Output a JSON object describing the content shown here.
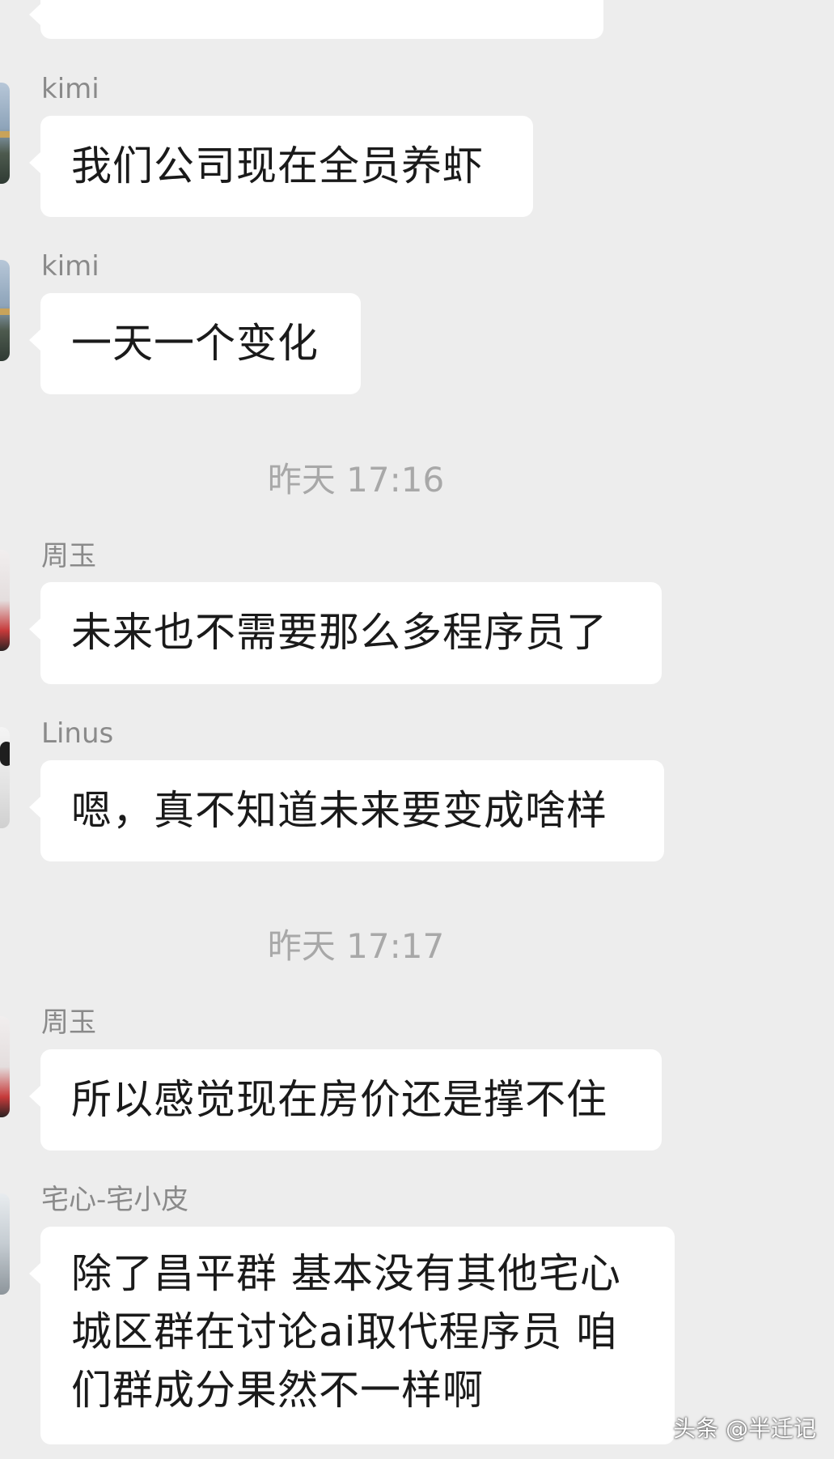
{
  "messages": [
    {
      "sender": "",
      "text": ""
    },
    {
      "sender": "kimi",
      "text": "我们公司现在全员养虾"
    },
    {
      "sender": "kimi",
      "text": "一天一个变化"
    },
    {
      "sender": "周玉",
      "text": "未来也不需要那么多程序员了"
    },
    {
      "sender": "Linus",
      "text": "嗯，真不知道未来要变成啥样"
    },
    {
      "sender": "周玉",
      "text": "所以感觉现在房价还是撑不住"
    },
    {
      "sender": "宅心-宅小皮",
      "text": "除了昌平群 基本没有其他宅心城区群在讨论ai取代程序员 咱们群成分果然不一样啊"
    }
  ],
  "timestamps": [
    "昨天 17:16",
    "昨天 17:17"
  ],
  "watermark": "头条 @半迁记"
}
